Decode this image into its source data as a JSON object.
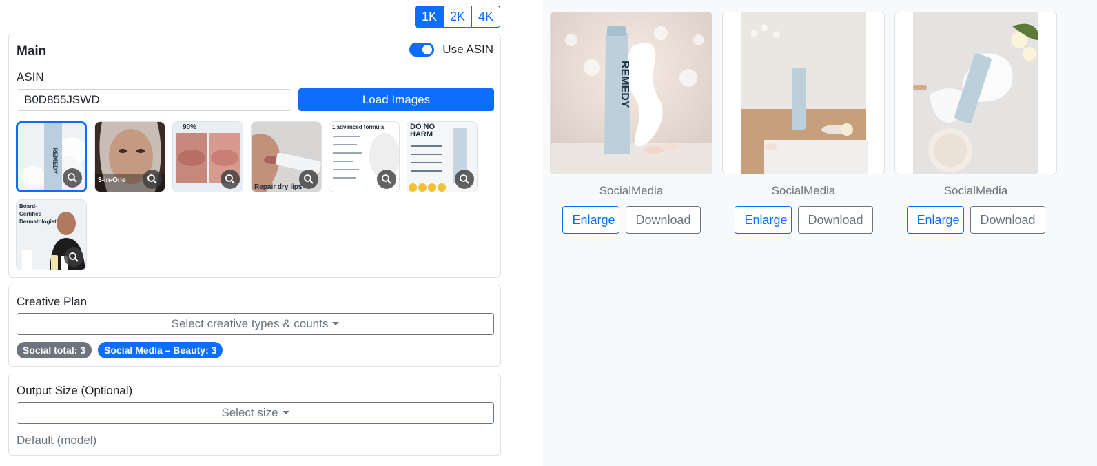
{
  "resolution": {
    "options": [
      "1K",
      "2K",
      "4K"
    ],
    "selected": "1K"
  },
  "main": {
    "title": "Main",
    "use_asin_label": "Use ASIN",
    "use_asin_on": true,
    "asin_label": "ASIN",
    "asin_value": "B0D855JSWD",
    "load_button": "Load Images",
    "thumbnails": [
      {
        "name": "product-tube",
        "overlay": ""
      },
      {
        "name": "woman-face",
        "overlay": "3-in-One"
      },
      {
        "name": "lips-comparison",
        "overlay": "90%"
      },
      {
        "name": "lips-application",
        "overlay": "Repair dry lips"
      },
      {
        "name": "formula-list",
        "overlay": "1 advanced formula"
      },
      {
        "name": "do-no-harm",
        "overlay": "DO NO HARM"
      },
      {
        "name": "dermatologist",
        "overlay": "Board-Certified Dermatologist"
      }
    ]
  },
  "creative_plan": {
    "label": "Creative Plan",
    "dropdown": "Select creative types & counts",
    "badges": [
      {
        "text": "Social total: 3",
        "color": "#6c757d"
      },
      {
        "text": "Social Media – Beauty: 3",
        "color": "#0d6efd"
      }
    ]
  },
  "output_size": {
    "label": "Output Size (Optional)",
    "dropdown": "Select size",
    "hint": "Default (model)"
  },
  "results": [
    {
      "caption": "SocialMedia",
      "enlarge": "Enlarge",
      "download": "Download"
    },
    {
      "caption": "SocialMedia",
      "enlarge": "Enlarge",
      "download": "Download"
    },
    {
      "caption": "SocialMedia",
      "enlarge": "Enlarge",
      "download": "Download"
    }
  ],
  "product_brand": "REMEDY",
  "colors": {
    "accent": "#0d6efd",
    "secondary": "#6c757d",
    "panel_bg": "#f8f9fa"
  }
}
